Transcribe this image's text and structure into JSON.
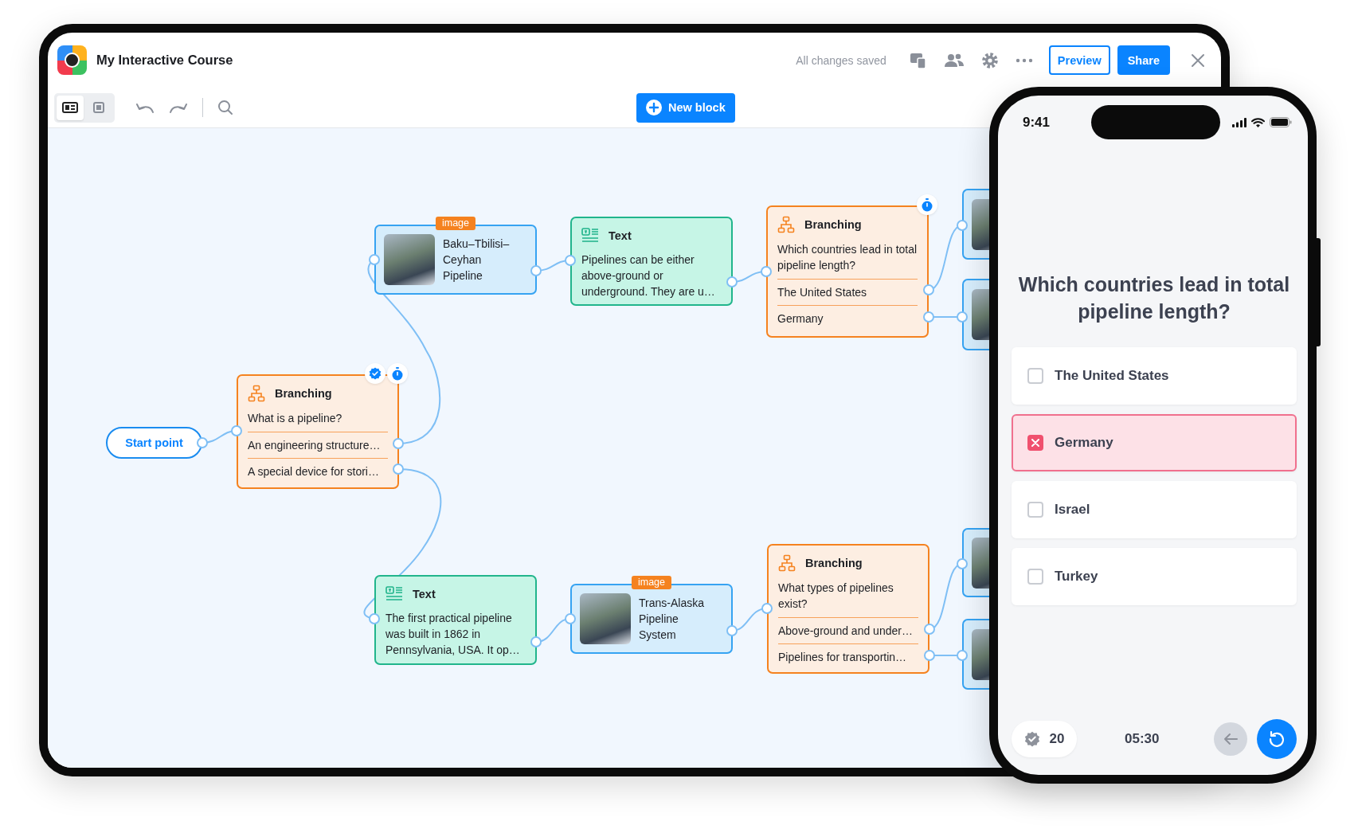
{
  "header": {
    "title": "My Interactive Course",
    "status": "All changes saved",
    "preview_button": "Preview",
    "share_button": "Share"
  },
  "toolbar": {
    "view_modes": [
      {
        "kind": "cards",
        "selected": true
      },
      {
        "kind": "blocks",
        "selected": false
      }
    ],
    "new_block_button": "New block"
  },
  "canvas": {
    "start_point": "Start point",
    "nodes": [
      {
        "kind": "branching",
        "title": "Branching",
        "question": "What is a pipeline?",
        "answers": [
          "An engineering structure…",
          "A special device for stori…"
        ],
        "badges": [
          {
            "kind": "check"
          },
          {
            "kind": "timer"
          }
        ]
      },
      {
        "kind": "image",
        "tag": "image",
        "caption": "Baku–Tbilisi–Ceyhan Pipeline"
      },
      {
        "kind": "text",
        "title": "Text",
        "body": "Pipelines can be either above-ground or underground. They are u…"
      },
      {
        "kind": "branching",
        "title": "Branching",
        "question": "Which countries lead in total pipeline length?",
        "answers": [
          "The United States",
          "Germany"
        ],
        "badges": [
          {
            "kind": "timer"
          }
        ]
      },
      {
        "kind": "image"
      },
      {
        "kind": "image"
      },
      {
        "kind": "text",
        "title": "Text",
        "body": "The first practical pipeline was built in 1862 in Pennsylvania, USA. It op…"
      },
      {
        "kind": "image",
        "tag": "image",
        "caption": "Trans-Alaska Pipeline System"
      },
      {
        "kind": "branching",
        "title": "Branching",
        "question": "What types of pipelines exist?",
        "answers": [
          "Above-ground and under…",
          "Pipelines for transportin…"
        ]
      },
      {
        "kind": "image"
      },
      {
        "kind": "image"
      }
    ]
  },
  "phone": {
    "time": "9:41",
    "question": "Which countries lead in total pipeline length?",
    "options": [
      {
        "label": "The United States",
        "selected": false
      },
      {
        "label": "Germany",
        "selected": true
      },
      {
        "label": "Israel",
        "selected": false
      },
      {
        "label": "Turkey",
        "selected": false
      }
    ],
    "score": "20",
    "timer": "05:30"
  }
}
